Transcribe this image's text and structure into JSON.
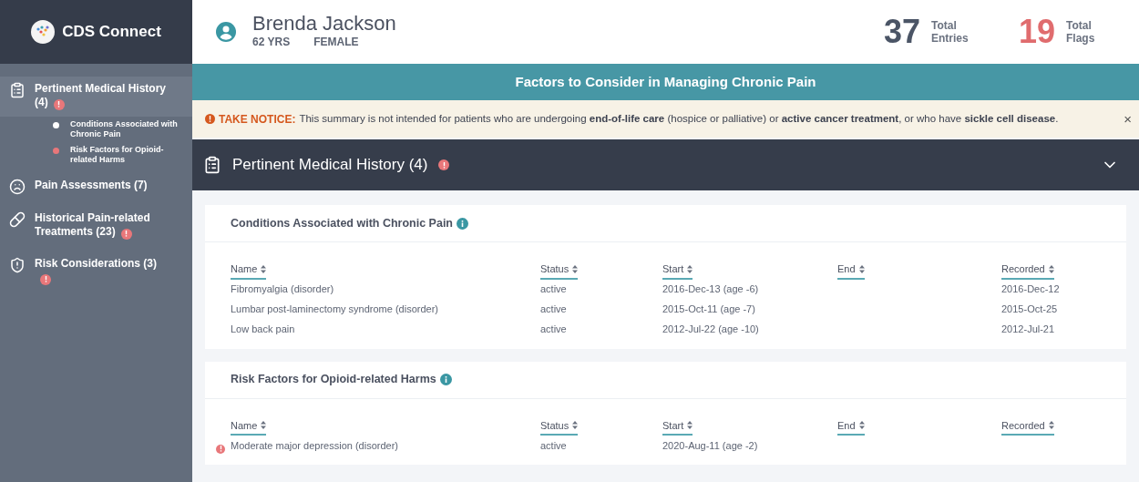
{
  "brand": {
    "name": "CDS Connect"
  },
  "patient": {
    "name": "Brenda Jackson",
    "age": "62 YRS",
    "gender": "FEMALE"
  },
  "stats": [
    {
      "value": "37",
      "label": "Total Entries",
      "kind": "entries"
    },
    {
      "value": "19",
      "label": "Total Flags",
      "kind": "flags"
    }
  ],
  "sidebar": {
    "items": [
      {
        "label": "Pertinent Medical History (4)",
        "kind": "clipboard",
        "flagged": true,
        "selected": true,
        "children": [
          {
            "label": "Conditions Associated with Chronic Pain",
            "flagged": false
          },
          {
            "label": "Risk Factors for Opioid-related Harms",
            "flagged": true
          }
        ]
      },
      {
        "label": "Pain Assessments (7)",
        "kind": "face",
        "flagged": false,
        "selected": false
      },
      {
        "label": "Historical Pain-related Treatments (23)",
        "kind": "pills",
        "flagged": true,
        "selected": false
      },
      {
        "label": "Risk Considerations (3)",
        "kind": "alert",
        "flagged": true,
        "selected": false
      }
    ]
  },
  "banner": {
    "title": "Factors to Consider in Managing Chronic Pain"
  },
  "notice": {
    "label": "TAKE NOTICE:",
    "text": "This summary is not intended for patients who are undergoing **end-of-life care** (hospice or palliative) or **active cancer treatment**, or who have **sickle cell disease**.",
    "close": "×"
  },
  "section": {
    "title": "Pertinent Medical History (4)",
    "flagged": true,
    "expanded": true
  },
  "tables": [
    {
      "title": "Conditions Associated with Chronic Pain",
      "columns": [
        "Name",
        "Status",
        "Start",
        "End",
        "Recorded"
      ],
      "rows": [
        {
          "flagged": false,
          "cells": [
            "Fibromyalgia (disorder)",
            "active",
            "2016-Dec-13 (age -6)",
            "",
            "2016-Dec-12"
          ]
        },
        {
          "flagged": false,
          "cells": [
            "Lumbar post-laminectomy syndrome (disorder)",
            "active",
            "2015-Oct-11 (age -7)",
            "",
            "2015-Oct-25"
          ]
        },
        {
          "flagged": false,
          "cells": [
            "Low back pain",
            "active",
            "2012-Jul-22 (age -10)",
            "",
            "2012-Jul-21"
          ]
        }
      ]
    },
    {
      "title": "Risk Factors for Opioid-related Harms",
      "columns": [
        "Name",
        "Status",
        "Start",
        "End",
        "Recorded"
      ],
      "rows": [
        {
          "flagged": true,
          "cells": [
            "Moderate major depression (disorder)",
            "active",
            "2020-Aug-11 (age -2)",
            "",
            ""
          ]
        }
      ]
    }
  ]
}
